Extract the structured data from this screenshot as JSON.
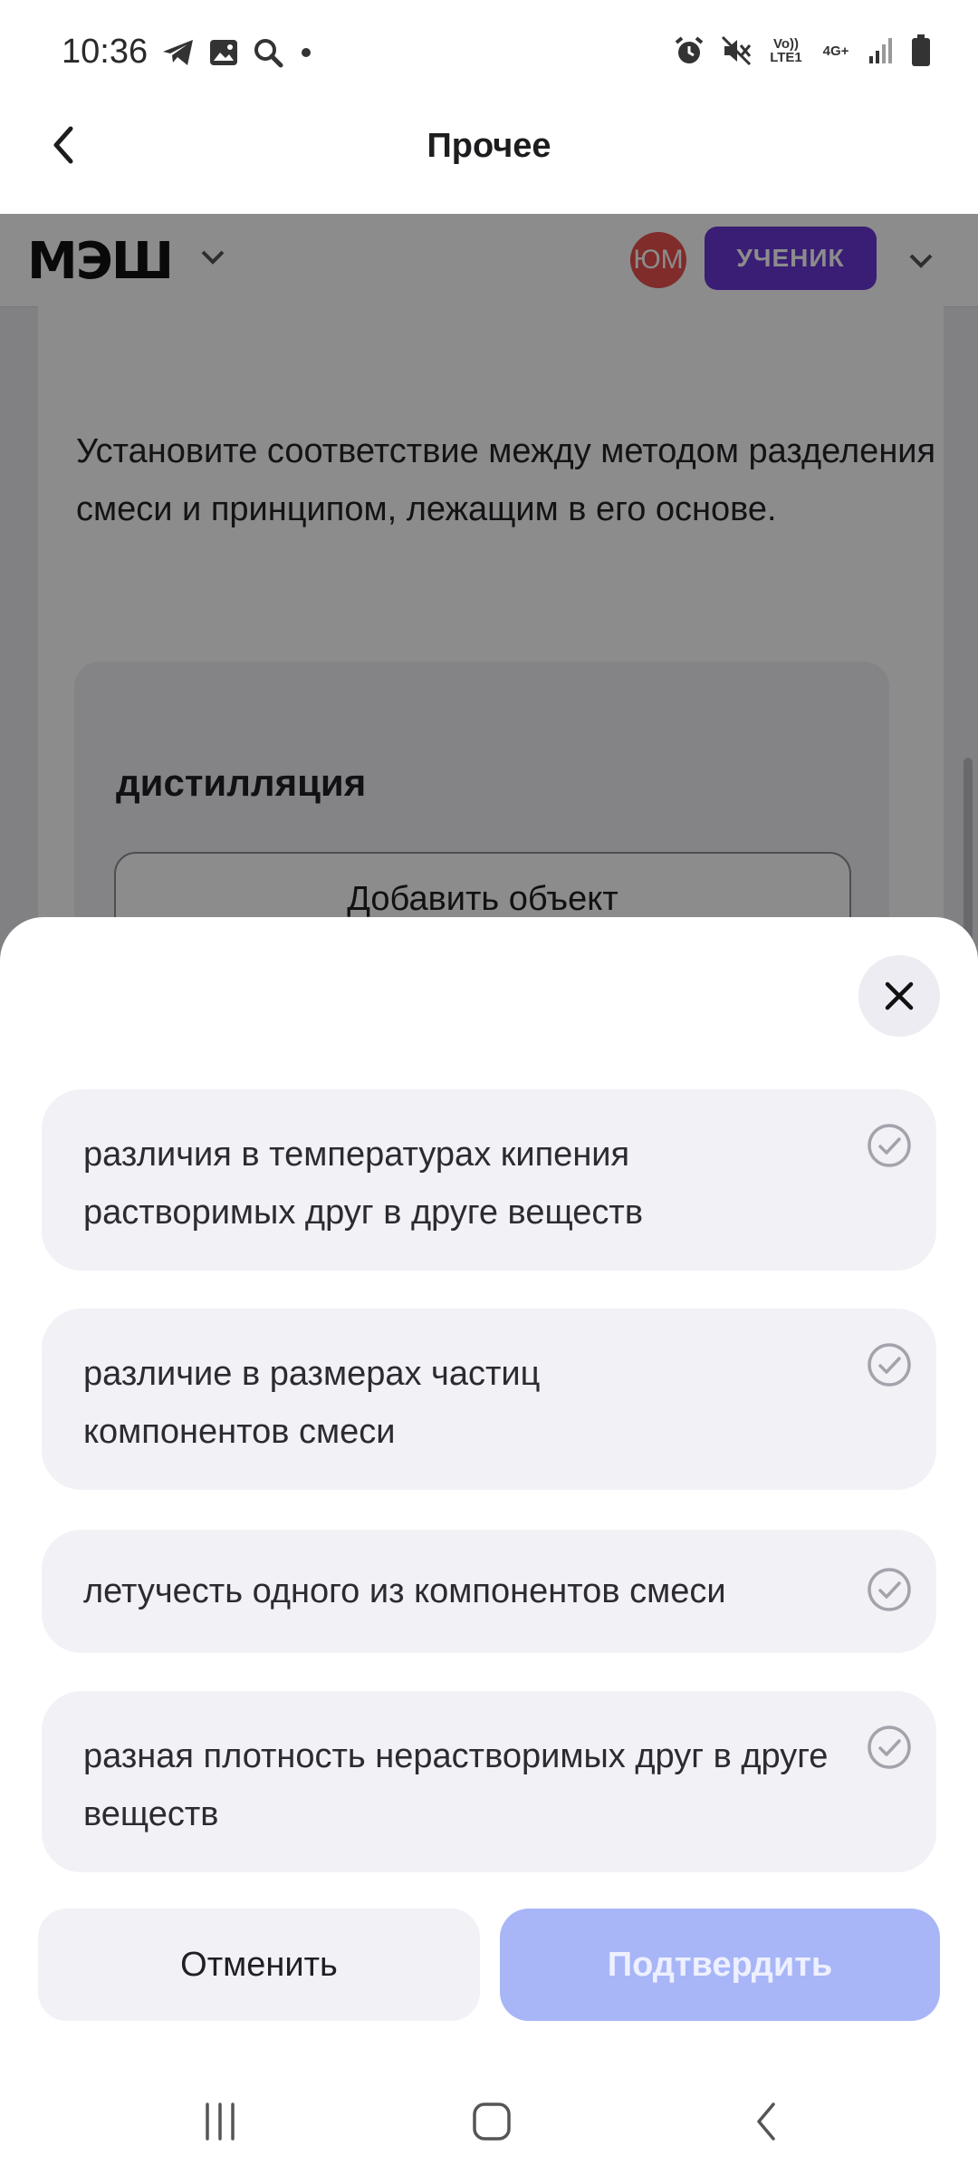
{
  "status_bar": {
    "time": "10:36",
    "left_icons": [
      "telegram-icon",
      "gallery-icon",
      "search-icon",
      "dot-icon"
    ],
    "right_icons": [
      "alarm-icon",
      "mute-icon",
      "volte-icon",
      "4g-icon",
      "signal-icon",
      "battery-icon"
    ],
    "volte_text": "Vo)) LTE1",
    "net_text": "4G+"
  },
  "header": {
    "title": "Прочее",
    "back_icon": "chevron-left-icon"
  },
  "page": {
    "logo": "МЭШ",
    "avatar_initials": "ЮМ",
    "role": "УЧЕНИК",
    "question": "Установите соответствие между методом разделения смеси и принципом, лежащим в его основе.",
    "method_label": "дистилляция",
    "add_button": "Добавить объект"
  },
  "sheet": {
    "close_icon": "close-icon",
    "options": [
      {
        "text": "различия в температурах кипения растворимых друг в друге веществ"
      },
      {
        "text": "различие в размерах частиц компонентов смеси"
      },
      {
        "text": "летучесть одного из компонентов смеси"
      },
      {
        "text": "разная плотность нерастворимых друг в друге веществ"
      }
    ],
    "cancel_label": "Отменить",
    "confirm_label": "Подтвердить"
  },
  "nav_bar": {
    "icons": [
      "recent-apps-icon",
      "home-icon",
      "back-icon"
    ]
  },
  "colors": {
    "accent_role": "#6a37d6",
    "avatar": "#e8504e",
    "confirm_disabled": "#a8b6f7",
    "option_bg": "#f1f1f6"
  }
}
